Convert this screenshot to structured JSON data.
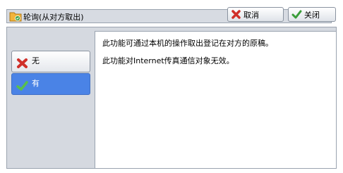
{
  "window": {
    "title": "轮询(从对方取出)",
    "icon": "folder-icon"
  },
  "toolbar": {
    "cancel_label": "取消",
    "close_label": "关闭"
  },
  "options": [
    {
      "label": "无",
      "icon": "red-x-icon",
      "selected": false
    },
    {
      "label": "有",
      "icon": "green-check-icon",
      "selected": true
    }
  ],
  "messages": [
    "此功能可通过本机的操作取出登记在对方的原稿。",
    "此功能对Internet传真通信对象无效。"
  ],
  "colors": {
    "selected": "#4a83e6",
    "panel": "#d5d9e0"
  }
}
